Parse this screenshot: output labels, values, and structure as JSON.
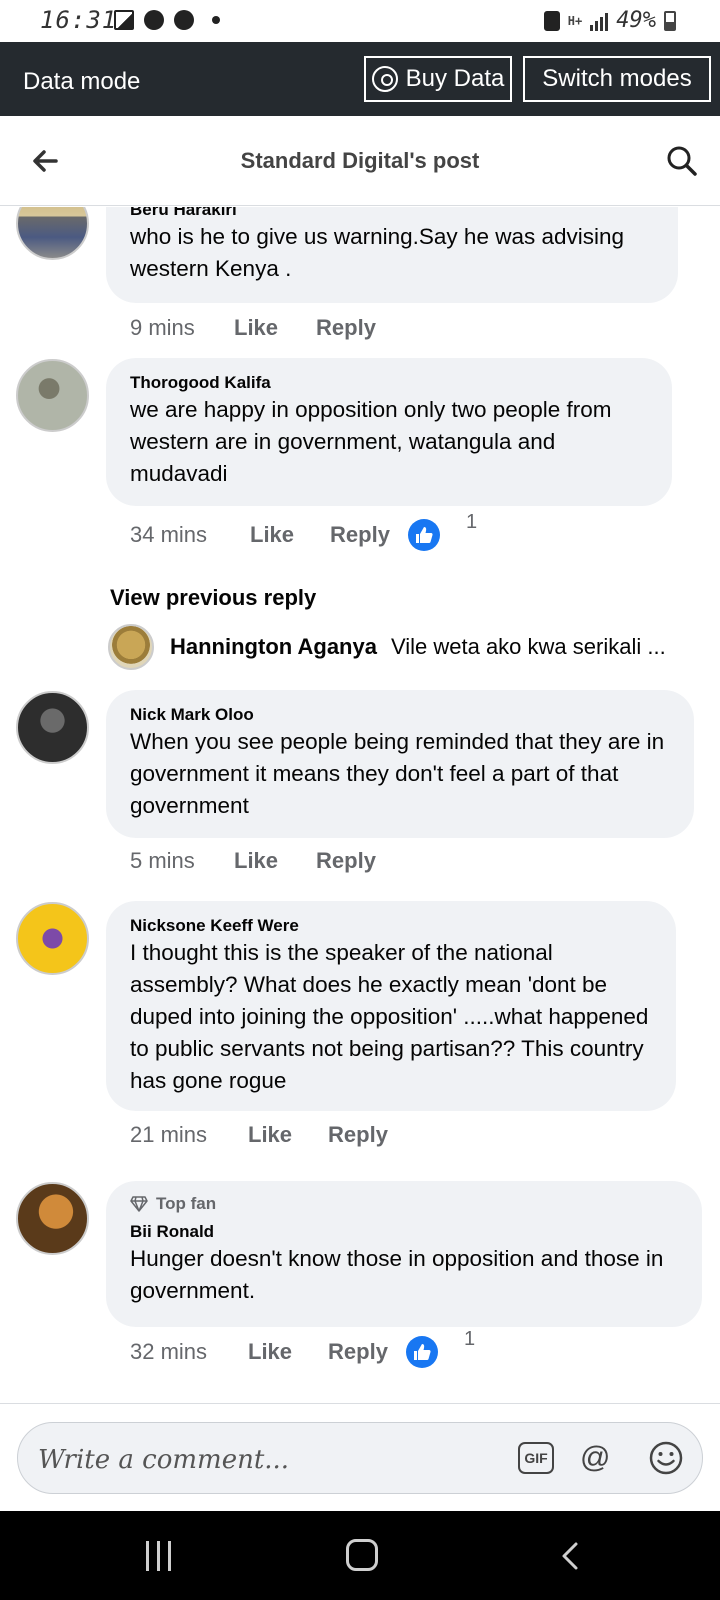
{
  "status_bar": {
    "time": "16:31",
    "battery": "49%",
    "network": "H+"
  },
  "data_mode": {
    "title": "Data mode",
    "buy_label": "Buy Data",
    "switch_label": "Switch modes"
  },
  "header": {
    "title": "Standard Digital's post"
  },
  "comments": [
    {
      "author": "Beru Harakiri",
      "text": "who is he to give us warning.Say he was advising western Kenya .",
      "time": "9 mins",
      "like": "Like",
      "reply": "Reply"
    },
    {
      "author": "Thorogood Kalifa",
      "text": "we are happy in opposition only two people from western are in government, watangula and mudavadi",
      "time": "34 mins",
      "like": "Like",
      "reply": "Reply",
      "reactions": "1"
    },
    {
      "author": "Nick Mark Oloo",
      "text": "When you see people being reminded that they are in government it means they don't feel a part of that government",
      "time": "5 mins",
      "like": "Like",
      "reply": "Reply"
    },
    {
      "author": "Nicksone Keeff Were",
      "text": "I thought this is the speaker of the national assembly? What does he exactly mean 'dont be duped into joining the opposition' .....what happened to public servants not being partisan?? This country has gone rogue",
      "time": "21 mins",
      "like": "Like",
      "reply": "Reply"
    },
    {
      "badge": "Top fan",
      "author": "Bii Ronald",
      "text": "Hunger doesn't know those in opposition and those in government.",
      "time": "32 mins",
      "like": "Like",
      "reply": "Reply",
      "reactions": "1"
    }
  ],
  "view_previous_reply": "View previous reply",
  "reply_preview": {
    "author": "Hannington Aganya",
    "text": "Vile weta ako kwa serikali ..."
  },
  "composer": {
    "placeholder": "Write a comment...",
    "gif_label": "GIF",
    "at_label": "@"
  }
}
